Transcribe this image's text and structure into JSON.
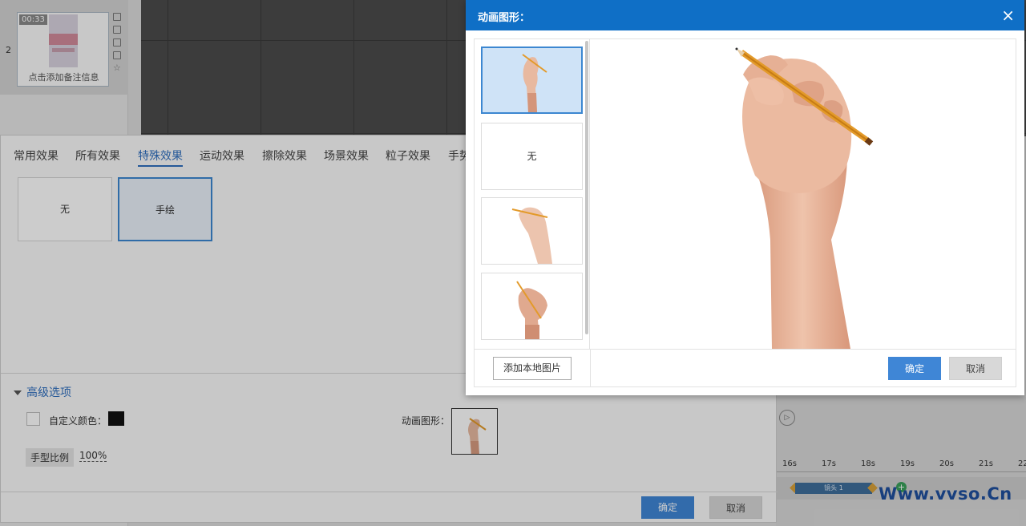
{
  "slide_panel": {
    "slide_number": "2",
    "duration": "00:33",
    "note_placeholder": "点击添加备注信息"
  },
  "timeline": {
    "ticks": [
      "16s",
      "17s",
      "18s",
      "19s",
      "20s",
      "21s",
      "22"
    ],
    "clip_label": "镜头 1"
  },
  "watermark": "Www.vvso.Cn",
  "effect_dialog": {
    "tabs": [
      "常用效果",
      "所有效果",
      "特殊效果",
      "运动效果",
      "擦除效果",
      "场景效果",
      "粒子效果",
      "手势"
    ],
    "active_tab": "特殊效果",
    "effects": [
      {
        "label": "无",
        "selected": false
      },
      {
        "label": "手绘",
        "selected": true
      }
    ],
    "advanced": {
      "title": "高级选项",
      "custom_color_label": "自定义颜色：",
      "custom_color_value": "#111111",
      "anim_graphic_label": "动画图形：",
      "hand_scale_label": "手型比例",
      "hand_scale_value": "100%"
    },
    "ok_label": "确定",
    "cancel_label": "取消"
  },
  "anim_dialog": {
    "title": "动画图形：",
    "close_glyph": "×",
    "items": [
      {
        "type": "hand-pencil-upright",
        "selected": true
      },
      {
        "type": "none",
        "label": "无",
        "selected": false
      },
      {
        "type": "hand-pencil-flat",
        "selected": false
      },
      {
        "type": "hand-pencil-diagonal",
        "selected": false
      }
    ],
    "add_local_label": "添加本地图片",
    "ok_label": "确定",
    "cancel_label": "取消"
  },
  "colors": {
    "header_blue": "#0f6fc6",
    "accent_blue": "#3f86d6",
    "skin": "#e8b9a0",
    "pencil": "#e39a2a"
  }
}
